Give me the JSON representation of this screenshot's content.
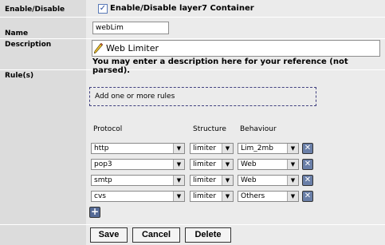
{
  "fields": {
    "enable_label": "Enable/Disable",
    "enable_checkbox_text": "Enable/Disable layer7 Container",
    "enable_checked": true,
    "name_label": "Name",
    "name_value": "webLim",
    "description_label": "Description",
    "description_value": "Web Limiter",
    "description_hint": "You may enter a description here for your reference (not parsed).",
    "rules_label": "Rule(s)"
  },
  "rules": {
    "placeholder": "Add one or more rules",
    "headers": {
      "protocol": "Protocol",
      "structure": "Structure",
      "behaviour": "Behaviour"
    },
    "rows": [
      {
        "protocol": "http",
        "structure": "limiter",
        "behaviour": "Lim_2mb"
      },
      {
        "protocol": "pop3",
        "structure": "limiter",
        "behaviour": "Web"
      },
      {
        "protocol": "smtp",
        "structure": "limiter",
        "behaviour": "Web"
      },
      {
        "protocol": "cvs",
        "structure": "limiter",
        "behaviour": "Others"
      }
    ]
  },
  "buttons": {
    "save": "Save",
    "cancel": "Cancel",
    "delete": "Delete"
  },
  "icons": {
    "delete_row": "delete-row-icon",
    "add_row": "add-row-icon",
    "pencil": "pencil-icon",
    "dropdown": "chevron-down-icon"
  },
  "colors": {
    "label_bg": "#dcdcdc",
    "field_bg": "#ebebeb",
    "dashed_border": "#404080"
  }
}
